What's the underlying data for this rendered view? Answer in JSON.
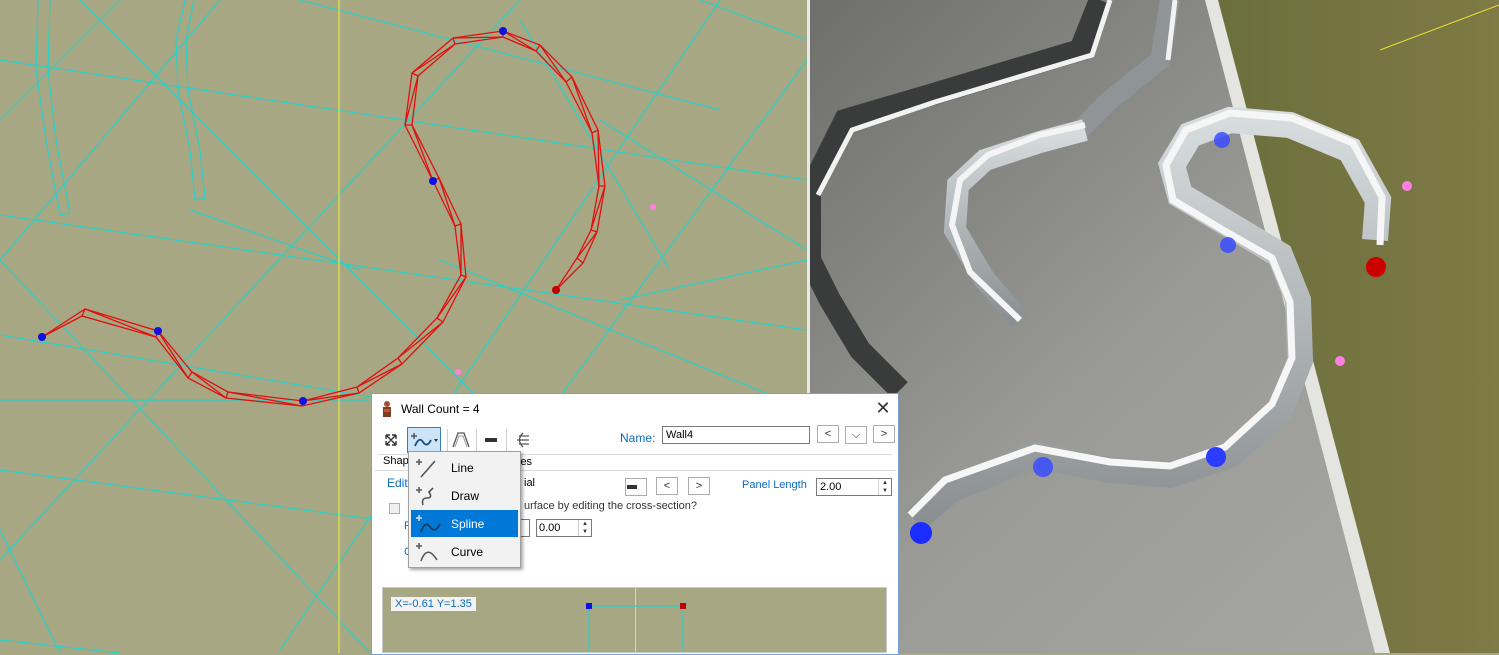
{
  "dialog": {
    "title": "Wall Count = 4",
    "close_glyph": "✕",
    "name_label": "Name:",
    "name_value": "Wall4",
    "nav_prev": "<",
    "nav_dropdown": "⌵",
    "nav_next": ">",
    "tab_shape_partial": "Shap",
    "tab_properties_partial": "ies",
    "edit_link_partial": "Edit",
    "material_partial": "ial",
    "surface_text_partial": "urface by editing the cross-section?",
    "panel_length_label": "Panel Length",
    "panel_length_value": "2.00",
    "offset_value": "0.00",
    "partial_p": "P",
    "partial_c": "C",
    "seg_prev": "<",
    "seg_next": ">",
    "coord_readout": "X=-0.61 Y=1.35"
  },
  "tool_dropdown": {
    "items": [
      {
        "label": "Line",
        "icon": "line-tool-icon"
      },
      {
        "label": "Draw",
        "icon": "draw-tool-icon"
      },
      {
        "label": "Spline",
        "icon": "spline-tool-icon"
      },
      {
        "label": "Curve",
        "icon": "curve-tool-icon"
      }
    ],
    "selected": "Spline"
  },
  "colors": {
    "viewport_bg": "#a7a883",
    "grid_lines": "#2ad0c8",
    "spline": "#e01010",
    "control_point": "#1010e0",
    "end_point": "#c00000",
    "selection_accent": "#0078d7",
    "link_blue": "#0b6bbf"
  }
}
